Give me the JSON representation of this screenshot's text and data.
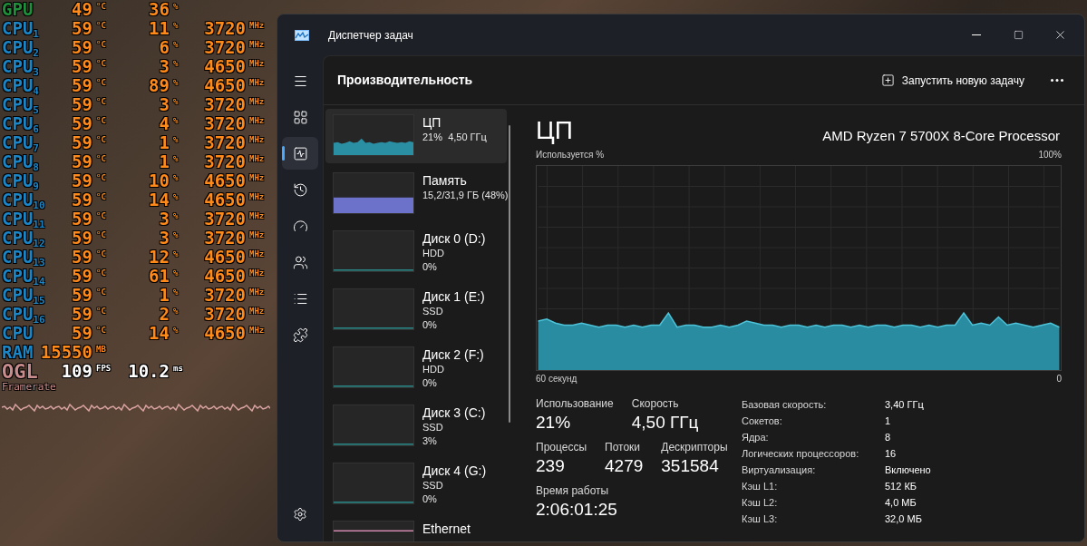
{
  "osd": {
    "rows": [
      {
        "kind": "gpu",
        "label": "GPU",
        "values": [
          {
            "text": "49",
            "unit": "°C"
          },
          {
            "text": "36",
            "unit": "%"
          }
        ]
      },
      {
        "kind": "cpu",
        "label": "CPU$_{1}$",
        "values": [
          {
            "text": "59",
            "unit": "°C"
          },
          {
            "text": "11",
            "unit": "%"
          },
          {
            "text": "3720",
            "unit": "MHz"
          }
        ]
      },
      {
        "kind": "cpu",
        "label": "CPU$_{2}$",
        "values": [
          {
            "text": "59",
            "unit": "°C"
          },
          {
            "text": "6",
            "unit": "%"
          },
          {
            "text": "3720",
            "unit": "MHz"
          }
        ]
      },
      {
        "kind": "cpu",
        "label": "CPU$_{3}$",
        "values": [
          {
            "text": "59",
            "unit": "°C"
          },
          {
            "text": "3",
            "unit": "%"
          },
          {
            "text": "4650",
            "unit": "MHz"
          }
        ]
      },
      {
        "kind": "cpu",
        "label": "CPU$_{4}$",
        "values": [
          {
            "text": "59",
            "unit": "°C"
          },
          {
            "text": "89",
            "unit": "%"
          },
          {
            "text": "4650",
            "unit": "MHz"
          }
        ]
      },
      {
        "kind": "cpu",
        "label": "CPU$_{5}$",
        "values": [
          {
            "text": "59",
            "unit": "°C"
          },
          {
            "text": "3",
            "unit": "%"
          },
          {
            "text": "3720",
            "unit": "MHz"
          }
        ]
      },
      {
        "kind": "cpu",
        "label": "CPU$_{6}$",
        "values": [
          {
            "text": "59",
            "unit": "°C"
          },
          {
            "text": "4",
            "unit": "%"
          },
          {
            "text": "3720",
            "unit": "MHz"
          }
        ]
      },
      {
        "kind": "cpu",
        "label": "CPU$_{7}$",
        "values": [
          {
            "text": "59",
            "unit": "°C"
          },
          {
            "text": "1",
            "unit": "%"
          },
          {
            "text": "3720",
            "unit": "MHz"
          }
        ]
      },
      {
        "kind": "cpu",
        "label": "CPU$_{8}$",
        "values": [
          {
            "text": "59",
            "unit": "°C"
          },
          {
            "text": "1",
            "unit": "%"
          },
          {
            "text": "3720",
            "unit": "MHz"
          }
        ]
      },
      {
        "kind": "cpu",
        "label": "CPU$_{9}$",
        "values": [
          {
            "text": "59",
            "unit": "°C"
          },
          {
            "text": "10",
            "unit": "%"
          },
          {
            "text": "4650",
            "unit": "MHz"
          }
        ]
      },
      {
        "kind": "cpu",
        "label": "CPU$_{10}$",
        "values": [
          {
            "text": "59",
            "unit": "°C"
          },
          {
            "text": "14",
            "unit": "%"
          },
          {
            "text": "4650",
            "unit": "MHz"
          }
        ]
      },
      {
        "kind": "cpu",
        "label": "CPU$_{11}$",
        "values": [
          {
            "text": "59",
            "unit": "°C"
          },
          {
            "text": "3",
            "unit": "%"
          },
          {
            "text": "3720",
            "unit": "MHz"
          }
        ]
      },
      {
        "kind": "cpu",
        "label": "CPU$_{12}$",
        "values": [
          {
            "text": "59",
            "unit": "°C"
          },
          {
            "text": "3",
            "unit": "%"
          },
          {
            "text": "3720",
            "unit": "MHz"
          }
        ]
      },
      {
        "kind": "cpu",
        "label": "CPU$_{13}$",
        "values": [
          {
            "text": "59",
            "unit": "°C"
          },
          {
            "text": "12",
            "unit": "%"
          },
          {
            "text": "4650",
            "unit": "MHz"
          }
        ]
      },
      {
        "kind": "cpu",
        "label": "CPU$_{14}$",
        "values": [
          {
            "text": "59",
            "unit": "°C"
          },
          {
            "text": "61",
            "unit": "%"
          },
          {
            "text": "4650",
            "unit": "MHz"
          }
        ]
      },
      {
        "kind": "cpu",
        "label": "CPU$_{15}$",
        "values": [
          {
            "text": "59",
            "unit": "°C"
          },
          {
            "text": "1",
            "unit": "%"
          },
          {
            "text": "3720",
            "unit": "MHz"
          }
        ]
      },
      {
        "kind": "cpu",
        "label": "CPU$_{16}$",
        "values": [
          {
            "text": "59",
            "unit": "°C"
          },
          {
            "text": "2",
            "unit": "%"
          },
          {
            "text": "3720",
            "unit": "MHz"
          }
        ]
      },
      {
        "kind": "cpu",
        "label": "CPU",
        "values": [
          {
            "text": "59",
            "unit": "°C"
          },
          {
            "text": "14",
            "unit": "%"
          },
          {
            "text": "4650",
            "unit": "MHz"
          }
        ]
      },
      {
        "kind": "ram",
        "label": "RAM",
        "values": [
          {
            "text": "15550",
            "unit": "MB"
          }
        ]
      },
      {
        "kind": "ogl",
        "label": "OGL",
        "values": [
          {
            "text": "109",
            "unit": "FPS"
          },
          {
            "text": "10.2",
            "unit": "ms"
          }
        ]
      }
    ],
    "graph_caption": "Framerate"
  },
  "window": {
    "title": "Диспетчер задач"
  },
  "nav_items": [
    {
      "selected": false
    },
    {
      "selected": false
    },
    {
      "selected": true
    },
    {
      "selected": false
    },
    {
      "selected": false
    },
    {
      "selected": false
    },
    {
      "selected": false
    },
    {
      "selected": false
    }
  ],
  "page": {
    "title": "Производительность",
    "run_task_button": "Запустить новую задачу"
  },
  "devices": [
    {
      "kind": "cpu",
      "name": "ЦП",
      "line_2": "21%  4,50 ГГц",
      "selected": true
    },
    {
      "kind": "memory",
      "name": "Память",
      "line_2": "15,2/31,9 ГБ (48%)",
      "selected": false
    },
    {
      "kind": "disk",
      "name": "Диск 0 (D:)",
      "line_2": "HDD",
      "line_3": "0%",
      "selected": false
    },
    {
      "kind": "disk",
      "name": "Диск 1 (E:)",
      "line_2": "SSD",
      "line_3": "0%",
      "selected": false
    },
    {
      "kind": "disk",
      "name": "Диск 2 (F:)",
      "line_2": "HDD",
      "line_3": "0%",
      "selected": false
    },
    {
      "kind": "disk",
      "name": "Диск 3 (C:)",
      "line_2": "SSD",
      "line_3": "3%",
      "selected": false
    },
    {
      "kind": "disk",
      "name": "Диск 4 (G:)",
      "line_2": "SSD",
      "line_3": "0%",
      "selected": false
    },
    {
      "kind": "network",
      "name": "Ethernet",
      "selected": false
    }
  ],
  "detail": {
    "title": "ЦП",
    "processor": "AMD Ryzen 7 5700X 8-Core Processor",
    "chart_label": "Используется %",
    "chart_max": "100%",
    "chart_time": "60 секунд",
    "chart_min": "0",
    "stat_rows": [
      [
        {
          "label": "Использование",
          "value": "21%"
        },
        {
          "label": "Скорость",
          "value": "4,50 ГГц"
        }
      ],
      [
        {
          "label": "Процессы",
          "value": "239"
        },
        {
          "label": "Потоки",
          "value": "4279"
        },
        {
          "label": "Дескрипторы",
          "value": "351584"
        }
      ],
      [
        {
          "label": "Время работы",
          "value": "2:06:01:25"
        }
      ]
    ],
    "specs": [
      {
        "label": "Базовая скорость:",
        "value": "3,40 ГГц"
      },
      {
        "label": "Сокетов:",
        "value": "1"
      },
      {
        "label": "Ядра:",
        "value": "8"
      },
      {
        "label": "Логических процессоров:",
        "value": "16"
      },
      {
        "label": "Виртуализация:",
        "value": "Включено"
      },
      {
        "label": "Кэш L1:",
        "value": "512 КБ"
      },
      {
        "label": "Кэш L2:",
        "value": "4,0 МБ"
      },
      {
        "label": "Кэш L3:",
        "value": "32,0 МБ"
      }
    ]
  }
}
